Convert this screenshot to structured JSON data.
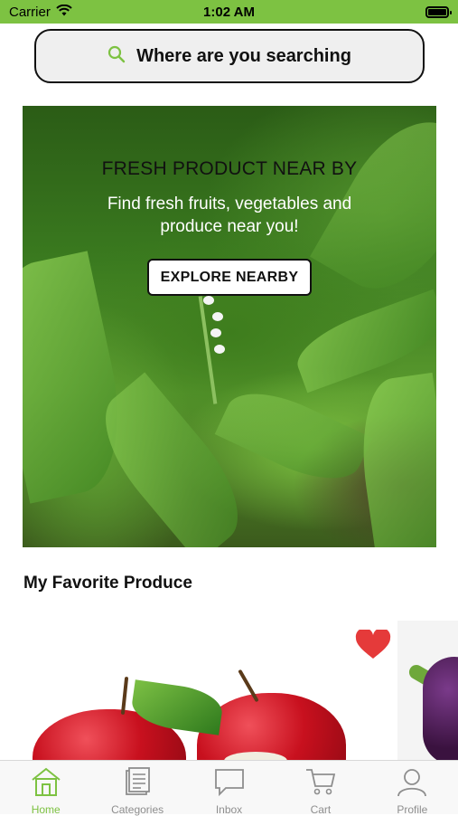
{
  "status_bar": {
    "carrier": "Carrier",
    "time": "1:02 AM"
  },
  "search": {
    "placeholder": "Where are you searching"
  },
  "hero": {
    "title": "FRESH PRODUCT NEAR BY",
    "subtitle": "Find fresh fruits, vegetables and produce near you!",
    "button_label": "EXPLORE NEARBY"
  },
  "favorites": {
    "title": "My Favorite Produce"
  },
  "tabs": [
    {
      "label": "Home",
      "icon": "home-icon",
      "active": true
    },
    {
      "label": "Categories",
      "icon": "categories-icon",
      "active": false
    },
    {
      "label": "Inbox",
      "icon": "inbox-icon",
      "active": false
    },
    {
      "label": "Cart",
      "icon": "cart-icon",
      "active": false
    },
    {
      "label": "Profile",
      "icon": "profile-icon",
      "active": false
    }
  ],
  "colors": {
    "accent": "#7dc242",
    "heart": "#e53a3a",
    "inactive": "#8e8e8e"
  }
}
